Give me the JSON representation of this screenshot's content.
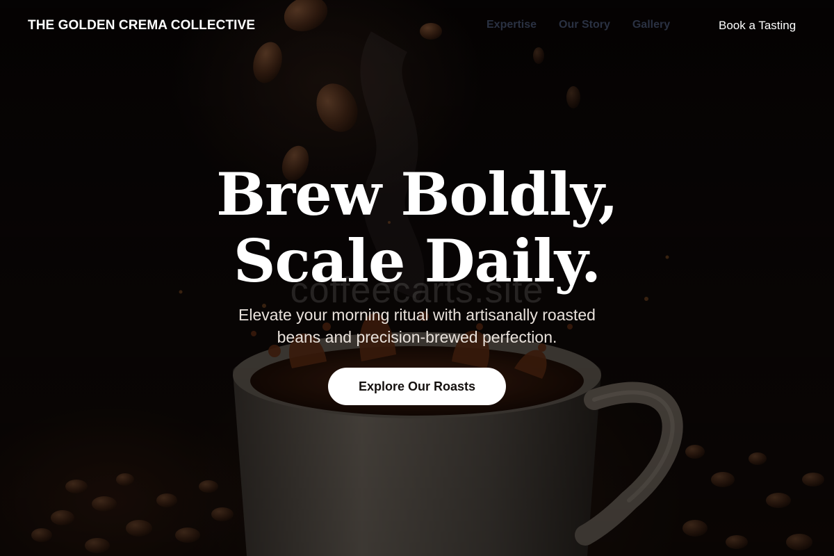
{
  "nav": {
    "brand": "THE GOLDEN CREMA COLLECTIVE",
    "links": [
      "Expertise",
      "Our Story",
      "Gallery"
    ],
    "cta": "Book a Tasting"
  },
  "hero": {
    "headline_lines": [
      "Brew Boldly,",
      "Scale Daily."
    ],
    "subhead_lines": [
      "Elevate your morning ritual with artisanally roasted",
      "beans and precision-brewed perfection."
    ],
    "button": "Explore Our Roasts",
    "watermark": "coffeecarts.site"
  },
  "colors": {
    "background": "#0a0605",
    "text_primary": "#ffffff",
    "nav_link": "#2a3142",
    "button_bg": "#ffffff",
    "button_text": "#14100e"
  },
  "icons": {
    "background_art": "coffee-cup-splash-illustration"
  }
}
